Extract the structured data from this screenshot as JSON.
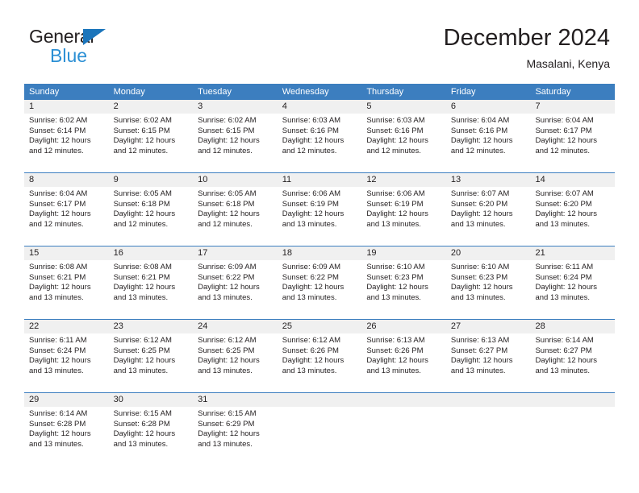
{
  "logo": {
    "word1": "General",
    "word2": "Blue",
    "brand_color": "#2b8fd4"
  },
  "header": {
    "title": "December 2024",
    "subtitle": "Masalani, Kenya"
  },
  "calendar": {
    "header_color": "#3c7ebf",
    "weekdays": [
      "Sunday",
      "Monday",
      "Tuesday",
      "Wednesday",
      "Thursday",
      "Friday",
      "Saturday"
    ],
    "weeks": [
      [
        {
          "day": "1",
          "sunrise": "Sunrise: 6:02 AM",
          "sunset": "Sunset: 6:14 PM",
          "daylight1": "Daylight: 12 hours",
          "daylight2": "and 12 minutes."
        },
        {
          "day": "2",
          "sunrise": "Sunrise: 6:02 AM",
          "sunset": "Sunset: 6:15 PM",
          "daylight1": "Daylight: 12 hours",
          "daylight2": "and 12 minutes."
        },
        {
          "day": "3",
          "sunrise": "Sunrise: 6:02 AM",
          "sunset": "Sunset: 6:15 PM",
          "daylight1": "Daylight: 12 hours",
          "daylight2": "and 12 minutes."
        },
        {
          "day": "4",
          "sunrise": "Sunrise: 6:03 AM",
          "sunset": "Sunset: 6:16 PM",
          "daylight1": "Daylight: 12 hours",
          "daylight2": "and 12 minutes."
        },
        {
          "day": "5",
          "sunrise": "Sunrise: 6:03 AM",
          "sunset": "Sunset: 6:16 PM",
          "daylight1": "Daylight: 12 hours",
          "daylight2": "and 12 minutes."
        },
        {
          "day": "6",
          "sunrise": "Sunrise: 6:04 AM",
          "sunset": "Sunset: 6:16 PM",
          "daylight1": "Daylight: 12 hours",
          "daylight2": "and 12 minutes."
        },
        {
          "day": "7",
          "sunrise": "Sunrise: 6:04 AM",
          "sunset": "Sunset: 6:17 PM",
          "daylight1": "Daylight: 12 hours",
          "daylight2": "and 12 minutes."
        }
      ],
      [
        {
          "day": "8",
          "sunrise": "Sunrise: 6:04 AM",
          "sunset": "Sunset: 6:17 PM",
          "daylight1": "Daylight: 12 hours",
          "daylight2": "and 12 minutes."
        },
        {
          "day": "9",
          "sunrise": "Sunrise: 6:05 AM",
          "sunset": "Sunset: 6:18 PM",
          "daylight1": "Daylight: 12 hours",
          "daylight2": "and 12 minutes."
        },
        {
          "day": "10",
          "sunrise": "Sunrise: 6:05 AM",
          "sunset": "Sunset: 6:18 PM",
          "daylight1": "Daylight: 12 hours",
          "daylight2": "and 12 minutes."
        },
        {
          "day": "11",
          "sunrise": "Sunrise: 6:06 AM",
          "sunset": "Sunset: 6:19 PM",
          "daylight1": "Daylight: 12 hours",
          "daylight2": "and 13 minutes."
        },
        {
          "day": "12",
          "sunrise": "Sunrise: 6:06 AM",
          "sunset": "Sunset: 6:19 PM",
          "daylight1": "Daylight: 12 hours",
          "daylight2": "and 13 minutes."
        },
        {
          "day": "13",
          "sunrise": "Sunrise: 6:07 AM",
          "sunset": "Sunset: 6:20 PM",
          "daylight1": "Daylight: 12 hours",
          "daylight2": "and 13 minutes."
        },
        {
          "day": "14",
          "sunrise": "Sunrise: 6:07 AM",
          "sunset": "Sunset: 6:20 PM",
          "daylight1": "Daylight: 12 hours",
          "daylight2": "and 13 minutes."
        }
      ],
      [
        {
          "day": "15",
          "sunrise": "Sunrise: 6:08 AM",
          "sunset": "Sunset: 6:21 PM",
          "daylight1": "Daylight: 12 hours",
          "daylight2": "and 13 minutes."
        },
        {
          "day": "16",
          "sunrise": "Sunrise: 6:08 AM",
          "sunset": "Sunset: 6:21 PM",
          "daylight1": "Daylight: 12 hours",
          "daylight2": "and 13 minutes."
        },
        {
          "day": "17",
          "sunrise": "Sunrise: 6:09 AM",
          "sunset": "Sunset: 6:22 PM",
          "daylight1": "Daylight: 12 hours",
          "daylight2": "and 13 minutes."
        },
        {
          "day": "18",
          "sunrise": "Sunrise: 6:09 AM",
          "sunset": "Sunset: 6:22 PM",
          "daylight1": "Daylight: 12 hours",
          "daylight2": "and 13 minutes."
        },
        {
          "day": "19",
          "sunrise": "Sunrise: 6:10 AM",
          "sunset": "Sunset: 6:23 PM",
          "daylight1": "Daylight: 12 hours",
          "daylight2": "and 13 minutes."
        },
        {
          "day": "20",
          "sunrise": "Sunrise: 6:10 AM",
          "sunset": "Sunset: 6:23 PM",
          "daylight1": "Daylight: 12 hours",
          "daylight2": "and 13 minutes."
        },
        {
          "day": "21",
          "sunrise": "Sunrise: 6:11 AM",
          "sunset": "Sunset: 6:24 PM",
          "daylight1": "Daylight: 12 hours",
          "daylight2": "and 13 minutes."
        }
      ],
      [
        {
          "day": "22",
          "sunrise": "Sunrise: 6:11 AM",
          "sunset": "Sunset: 6:24 PM",
          "daylight1": "Daylight: 12 hours",
          "daylight2": "and 13 minutes."
        },
        {
          "day": "23",
          "sunrise": "Sunrise: 6:12 AM",
          "sunset": "Sunset: 6:25 PM",
          "daylight1": "Daylight: 12 hours",
          "daylight2": "and 13 minutes."
        },
        {
          "day": "24",
          "sunrise": "Sunrise: 6:12 AM",
          "sunset": "Sunset: 6:25 PM",
          "daylight1": "Daylight: 12 hours",
          "daylight2": "and 13 minutes."
        },
        {
          "day": "25",
          "sunrise": "Sunrise: 6:12 AM",
          "sunset": "Sunset: 6:26 PM",
          "daylight1": "Daylight: 12 hours",
          "daylight2": "and 13 minutes."
        },
        {
          "day": "26",
          "sunrise": "Sunrise: 6:13 AM",
          "sunset": "Sunset: 6:26 PM",
          "daylight1": "Daylight: 12 hours",
          "daylight2": "and 13 minutes."
        },
        {
          "day": "27",
          "sunrise": "Sunrise: 6:13 AM",
          "sunset": "Sunset: 6:27 PM",
          "daylight1": "Daylight: 12 hours",
          "daylight2": "and 13 minutes."
        },
        {
          "day": "28",
          "sunrise": "Sunrise: 6:14 AM",
          "sunset": "Sunset: 6:27 PM",
          "daylight1": "Daylight: 12 hours",
          "daylight2": "and 13 minutes."
        }
      ],
      [
        {
          "day": "29",
          "sunrise": "Sunrise: 6:14 AM",
          "sunset": "Sunset: 6:28 PM",
          "daylight1": "Daylight: 12 hours",
          "daylight2": "and 13 minutes."
        },
        {
          "day": "30",
          "sunrise": "Sunrise: 6:15 AM",
          "sunset": "Sunset: 6:28 PM",
          "daylight1": "Daylight: 12 hours",
          "daylight2": "and 13 minutes."
        },
        {
          "day": "31",
          "sunrise": "Sunrise: 6:15 AM",
          "sunset": "Sunset: 6:29 PM",
          "daylight1": "Daylight: 12 hours",
          "daylight2": "and 13 minutes."
        },
        {
          "day": "",
          "sunrise": "",
          "sunset": "",
          "daylight1": "",
          "daylight2": ""
        },
        {
          "day": "",
          "sunrise": "",
          "sunset": "",
          "daylight1": "",
          "daylight2": ""
        },
        {
          "day": "",
          "sunrise": "",
          "sunset": "",
          "daylight1": "",
          "daylight2": ""
        },
        {
          "day": "",
          "sunrise": "",
          "sunset": "",
          "daylight1": "",
          "daylight2": ""
        }
      ]
    ]
  }
}
